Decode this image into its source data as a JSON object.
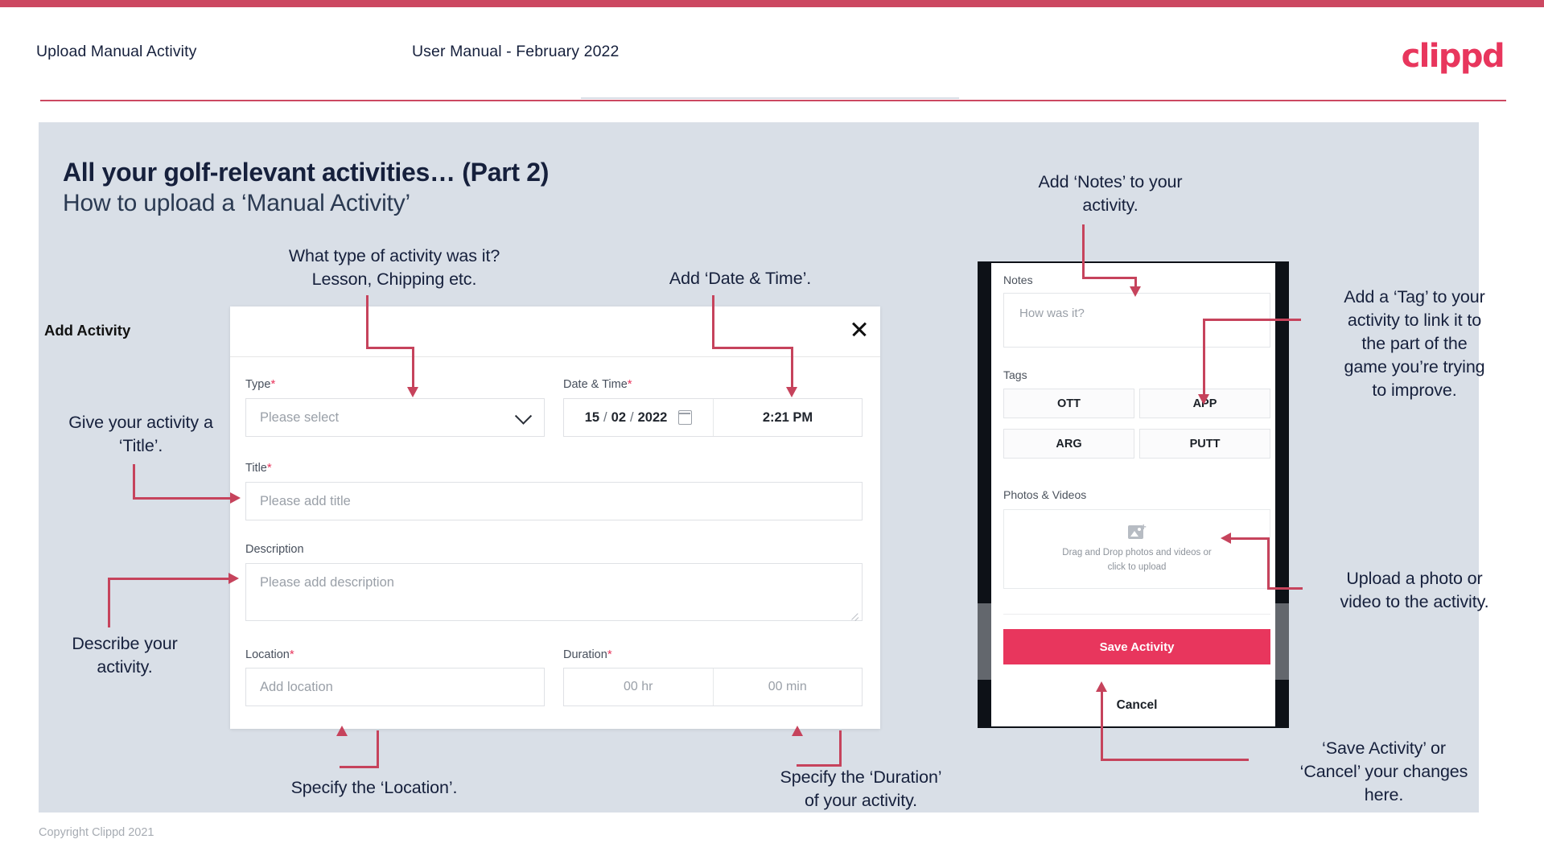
{
  "header": {
    "left_title": "Upload Manual Activity",
    "center_title": "User Manual - February 2022",
    "logo": "clippd"
  },
  "slide": {
    "heading": "All your golf-relevant activities… (Part 2)",
    "subheading": "How to upload a ‘Manual Activity’"
  },
  "modal": {
    "title": "Add Activity",
    "close_icon": "close-icon",
    "fields": {
      "type": {
        "label": "Type",
        "required": "*",
        "placeholder": "Please select",
        "chevron_icon": "chevron-down-icon"
      },
      "datetime": {
        "label": "Date & Time",
        "required": "*",
        "day": "15",
        "sep1": "/",
        "month": "02",
        "sep2": "/",
        "year": "2022",
        "calendar_icon": "calendar-icon",
        "time": "2:21 PM"
      },
      "title": {
        "label": "Title",
        "required": "*",
        "placeholder": "Please add title"
      },
      "description": {
        "label": "Description",
        "placeholder": "Please add description"
      },
      "location": {
        "label": "Location",
        "required": "*",
        "placeholder": "Add location"
      },
      "duration": {
        "label": "Duration",
        "required": "*",
        "hours": "00 hr",
        "minutes": "00 min"
      }
    }
  },
  "phone": {
    "notes": {
      "label": "Notes",
      "placeholder": "How was it?"
    },
    "tags": {
      "label": "Tags",
      "items": [
        "OTT",
        "APP",
        "ARG",
        "PUTT"
      ]
    },
    "media": {
      "label": "Photos & Videos",
      "icon": "add-image-icon",
      "line1": "Drag and Drop photos and videos or",
      "line2": "click to upload"
    },
    "save_label": "Save Activity",
    "cancel_label": "Cancel"
  },
  "annotations": {
    "type": "What type of activity was it?\nLesson, Chipping etc.",
    "type_l1": "What type of activity was it?",
    "type_l2": "Lesson, Chipping etc.",
    "datetime": "Add ‘Date & Time’.",
    "title_l1": "Give your activity a",
    "title_l2": "‘Title’.",
    "description_l1": "Describe your",
    "description_l2": "activity.",
    "location": "Specify the ‘Location’.",
    "duration_l1": "Specify the ‘Duration’",
    "duration_l2": "of your activity.",
    "notes_l1": "Add ‘Notes’ to your",
    "notes_l2": "activity.",
    "tag": "Add a ‘Tag’ to your activity to link it to the part of the game you’re trying to improve.",
    "tag_l1": "Add a ‘Tag’ to your",
    "tag_l2": "activity to link it to",
    "tag_l3": "the part of the",
    "tag_l4": "game you’re trying",
    "tag_l5": "to improve.",
    "upload_l1": "Upload a photo or",
    "upload_l2": "video to the activity.",
    "save_l1": "‘Save Activity’ or",
    "save_l2": "‘Cancel’ your changes",
    "save_l3": "here."
  },
  "footer": {
    "copyright": "Copyright Clippd 2021"
  },
  "colors": {
    "accent": "#e8365d",
    "arrow": "#c6435c",
    "slide_bg": "#d9dfe7",
    "text": "#16203c"
  }
}
